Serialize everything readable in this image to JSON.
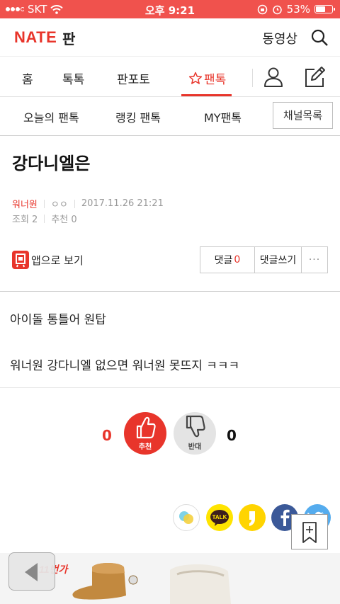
{
  "status_bar": {
    "carrier": "SKT",
    "time": "오후 9:21",
    "battery": "53%",
    "battery_level": 0.53
  },
  "header": {
    "logo": "NATE",
    "logo_sub": "판",
    "video_link": "동영상",
    "search_icon": "search-icon"
  },
  "tabs": {
    "items": [
      {
        "label": "홈"
      },
      {
        "label": "톡톡"
      },
      {
        "label": "판포토"
      },
      {
        "label": "팬톡",
        "active": true
      }
    ],
    "user_icon": "user-icon",
    "write_icon": "write-icon"
  },
  "subtabs": {
    "items": [
      {
        "label": "오늘의 팬톡"
      },
      {
        "label": "랭킹 팬톡"
      },
      {
        "label": "MY팬톡"
      }
    ],
    "channel_button": "채널목록"
  },
  "post": {
    "title": "강다니엘은",
    "author": "워너원",
    "nickname": "ㅇㅇ",
    "date": "2017.11.26 21:21",
    "views": "조회 2",
    "recommend": "추천 0",
    "app_view": "앱으로 보기",
    "comment_label": "댓글",
    "comment_count": "0",
    "write_comment": "댓글쓰기",
    "more": "···",
    "body": [
      "아이돌 통틀어 원탑",
      "워너원 강다니엘 없으면 워너원 못뜨지 ㅋㅋㅋ"
    ]
  },
  "vote": {
    "up_count": "0",
    "up_label": "추천",
    "down_label": "반대",
    "down_count": "0"
  },
  "share": {
    "talk_label": "TALK",
    "icons": [
      "kakaostory-icon",
      "kakaotalk-icon",
      "kakaostory-quote-icon",
      "facebook-icon",
      "twitter-icon"
    ]
  },
  "ad": {
    "brand": "11번가"
  },
  "colors": {
    "accent": "#e8352b",
    "status_bar": "#f0524d"
  }
}
